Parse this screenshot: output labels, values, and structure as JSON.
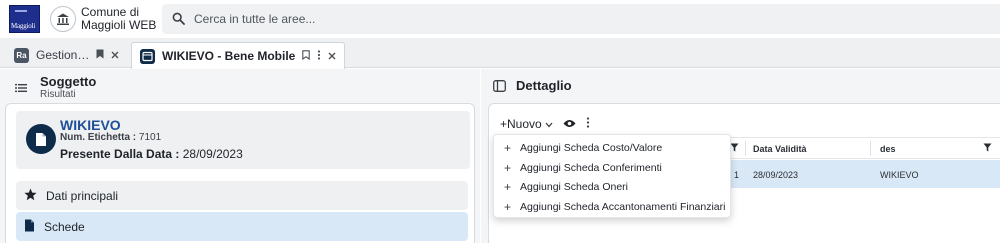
{
  "header": {
    "logo_text": "Maggioli",
    "org_line1": "Comune di",
    "org_line2": "Maggioli WEB",
    "search_placeholder": "Cerca in tutte le aree..."
  },
  "tabs": [
    {
      "label": "Gestion…",
      "icon_text": "Ra",
      "active": false
    },
    {
      "label": "WIKIEVO - Bene Mobile",
      "active": true
    }
  ],
  "left_panel": {
    "title": "Soggetto",
    "subtitle": "Risultati",
    "record": {
      "title": "WIKIEVO",
      "label_num": "Num. Etichetta : ",
      "value_num": "7101",
      "label_data": "Presente Dalla Data : ",
      "value_data": "28/09/2023"
    },
    "nav": [
      {
        "label": "Dati principali",
        "icon": "star-icon",
        "selected": false
      },
      {
        "label": "Schede",
        "icon": "document-icon",
        "selected": true
      }
    ]
  },
  "right_panel": {
    "title": "Dettaglio",
    "new_button": "+Nuovo",
    "menu_items": [
      "Aggiungi Scheda Costo/Valore",
      "Aggiungi Scheda Conferimenti",
      "Aggiungi Scheda Oneri",
      "Aggiungi Scheda Accantonamenti Finanziari"
    ],
    "table": {
      "columns": [
        "Data Validità",
        "des"
      ],
      "row": {
        "index": "1",
        "data_validita": "28/09/2023",
        "des": "WIKIEVO"
      }
    }
  },
  "colors": {
    "accent_dark": "#0f2b4a",
    "record_title": "#1e4f99",
    "selected_bg": "#d9e8f7",
    "panel_bg": "#f4f5f7"
  }
}
